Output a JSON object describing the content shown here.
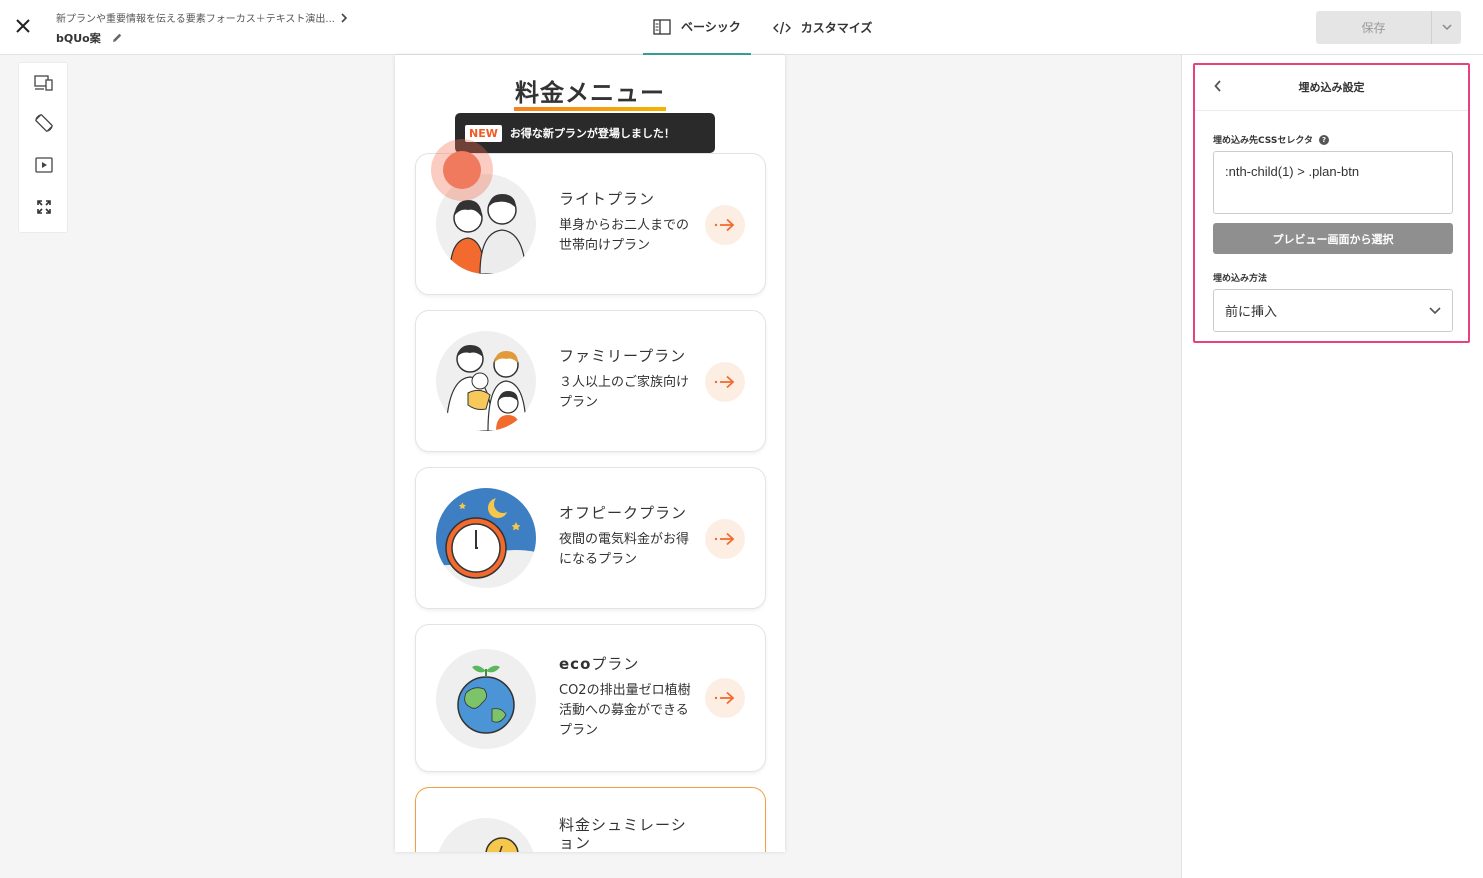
{
  "header": {
    "breadcrumb": "新プランや重要情報を伝える要素フォーカス＋テキスト演出...",
    "project_name": "bQUo案",
    "tabs": [
      {
        "label": "ベーシック",
        "active": true
      },
      {
        "label": "カスタマイズ",
        "active": false
      }
    ],
    "save_label": "保存"
  },
  "toolbar": {
    "tools": [
      "devices-icon",
      "rotate-icon",
      "play-icon",
      "fullscreen-icon"
    ]
  },
  "preview": {
    "title": "料金メニュー",
    "tooltip": {
      "badge": "NEW",
      "text": "お得な新プランが登場しました！"
    },
    "cards": [
      {
        "title": "ライトプラン",
        "description": "単身からお二人までの世帯向けプラン"
      },
      {
        "title": "ファミリープラン",
        "description": "３人以上のご家族向けプラン"
      },
      {
        "title": "オフピークプラン",
        "description": "夜間の電気料金がお得になるプラン"
      },
      {
        "title_bold": "eco",
        "title_rest": "プラン",
        "description": "CO2の排出量ゼロ植樹活動への募金ができるプラン"
      },
      {
        "title": "料金シュミレーション",
        "description": ""
      }
    ]
  },
  "panel": {
    "title": "埋め込み設定",
    "selector_label": "埋め込み先CSSセレクタ",
    "selector_value": ":nth-child(1) > .plan-btn",
    "pick_button": "プレビュー画面から選択",
    "method_label": "埋め込み方法",
    "method_value": "前に挿入"
  },
  "colors": {
    "accent": "#3aa39a",
    "highlight": "#e8417f",
    "orange": "#f58220"
  }
}
